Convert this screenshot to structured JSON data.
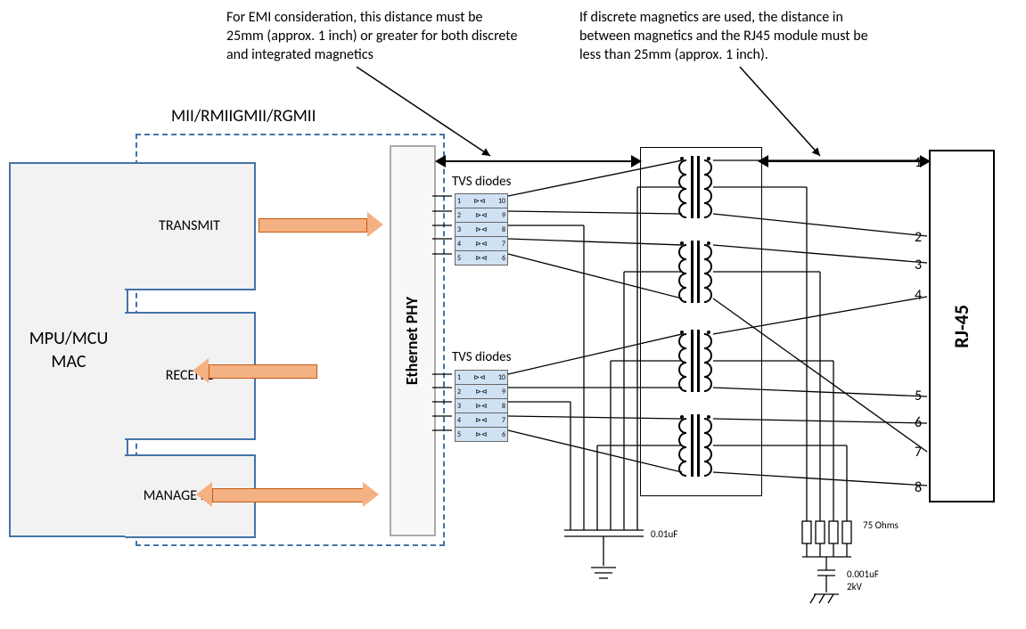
{
  "notes": {
    "left_note": "For EMI consideration, this distance must be 25mm (approx. 1 inch) or greater for both discrete and integrated magnetics",
    "right_note": "If discrete magnetics are used, the distance in between magnetics and the RJ45 module must be less than 25mm (approx. 1 inch)."
  },
  "interface_label": "MII/RMIIGMII/RGMII",
  "mcu": "MPU/MCU MAC",
  "sections": {
    "tx": "TRANSMIT",
    "rx": "RECEIVE",
    "mgmt": "MANAGE MENT"
  },
  "phy": "Ethernet PHY",
  "tvs_label": "TVS diodes",
  "rj45": "RJ-45",
  "pins": [
    "1",
    "2",
    "3",
    "4",
    "5",
    "6",
    "7",
    "8"
  ],
  "caps": {
    "c1": "0.01uF",
    "c2_val": "0.001uF",
    "c2_rating": "2kV"
  },
  "res_label": "75 Ohms",
  "tvs_pins": {
    "left": [
      "1",
      "2",
      "3",
      "4",
      "5"
    ],
    "right": [
      "10",
      "9",
      "8",
      "7",
      "6"
    ]
  }
}
